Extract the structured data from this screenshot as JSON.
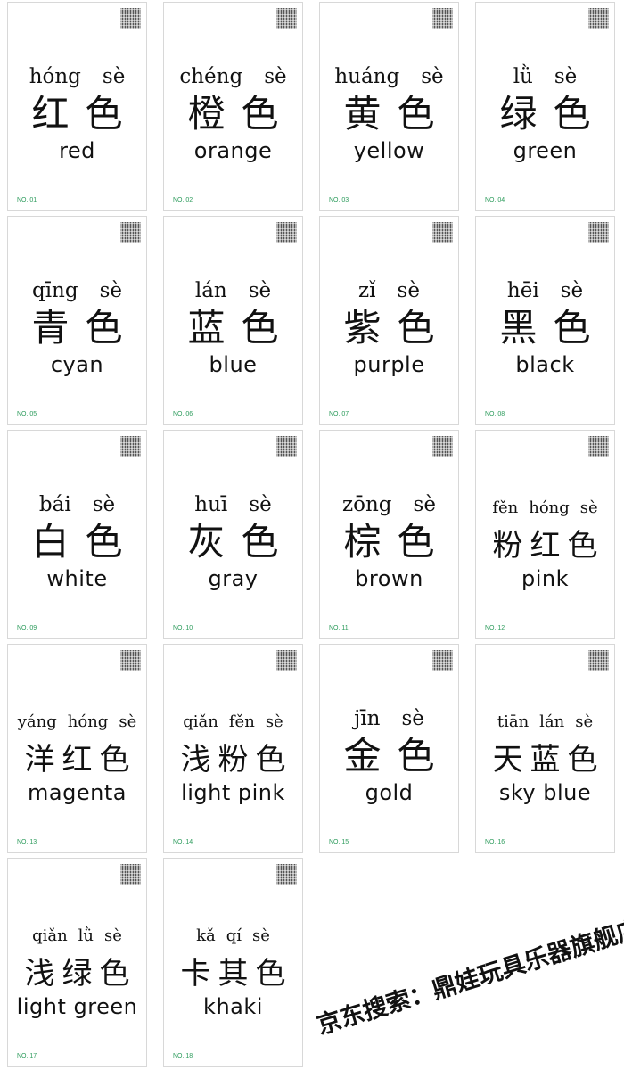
{
  "cards": [
    {
      "no": "NO. 01",
      "pinyin": [
        "hóng",
        "sè"
      ],
      "hanzi": [
        "红",
        "色"
      ],
      "english": "red"
    },
    {
      "no": "NO. 02",
      "pinyin": [
        "chéng",
        "sè"
      ],
      "hanzi": [
        "橙",
        "色"
      ],
      "english": "orange"
    },
    {
      "no": "NO. 03",
      "pinyin": [
        "huáng",
        "sè"
      ],
      "hanzi": [
        "黄",
        "色"
      ],
      "english": "yellow"
    },
    {
      "no": "NO. 04",
      "pinyin": [
        "lǜ",
        "sè"
      ],
      "hanzi": [
        "绿",
        "色"
      ],
      "english": "green"
    },
    {
      "no": "NO. 05",
      "pinyin": [
        "qīng",
        "sè"
      ],
      "hanzi": [
        "青",
        "色"
      ],
      "english": "cyan"
    },
    {
      "no": "NO. 06",
      "pinyin": [
        "lán",
        "sè"
      ],
      "hanzi": [
        "蓝",
        "色"
      ],
      "english": "blue"
    },
    {
      "no": "NO. 07",
      "pinyin": [
        "zǐ",
        "sè"
      ],
      "hanzi": [
        "紫",
        "色"
      ],
      "english": "purple"
    },
    {
      "no": "NO. 08",
      "pinyin": [
        "hēi",
        "sè"
      ],
      "hanzi": [
        "黑",
        "色"
      ],
      "english": "black"
    },
    {
      "no": "NO. 09",
      "pinyin": [
        "bái",
        "sè"
      ],
      "hanzi": [
        "白",
        "色"
      ],
      "english": "white"
    },
    {
      "no": "NO. 10",
      "pinyin": [
        "huī",
        "sè"
      ],
      "hanzi": [
        "灰",
        "色"
      ],
      "english": "gray"
    },
    {
      "no": "NO. 11",
      "pinyin": [
        "zōng",
        "sè"
      ],
      "hanzi": [
        "棕",
        "色"
      ],
      "english": "brown"
    },
    {
      "no": "NO. 12",
      "pinyin": [
        "fěn",
        "hóng",
        "sè"
      ],
      "hanzi": [
        "粉",
        "红",
        "色"
      ],
      "english": "pink"
    },
    {
      "no": "NO. 13",
      "pinyin": [
        "yáng",
        "hóng",
        "sè"
      ],
      "hanzi": [
        "洋",
        "红",
        "色"
      ],
      "english": "magenta"
    },
    {
      "no": "NO. 14",
      "pinyin": [
        "qiǎn",
        "fěn",
        "sè"
      ],
      "hanzi": [
        "浅",
        "粉",
        "色"
      ],
      "english": "light pink"
    },
    {
      "no": "NO. 15",
      "pinyin": [
        "jīn",
        "sè"
      ],
      "hanzi": [
        "金",
        "色"
      ],
      "english": "gold"
    },
    {
      "no": "NO. 16",
      "pinyin": [
        "tiān",
        "lán",
        "sè"
      ],
      "hanzi": [
        "天",
        "蓝",
        "色"
      ],
      "english": "sky blue"
    },
    {
      "no": "NO. 17",
      "pinyin": [
        "qiǎn",
        "lǜ",
        "sè"
      ],
      "hanzi": [
        "浅",
        "绿",
        "色"
      ],
      "english": "light green"
    },
    {
      "no": "NO. 18",
      "pinyin": [
        "kǎ",
        "qí",
        "sè"
      ],
      "hanzi": [
        "卡",
        "其",
        "色"
      ],
      "english": "khaki"
    }
  ],
  "watermark": "京东搜索：鼎娃玩具乐器旗舰店",
  "colors": {
    "number_label": "#2a9a5a",
    "text": "#111111"
  }
}
